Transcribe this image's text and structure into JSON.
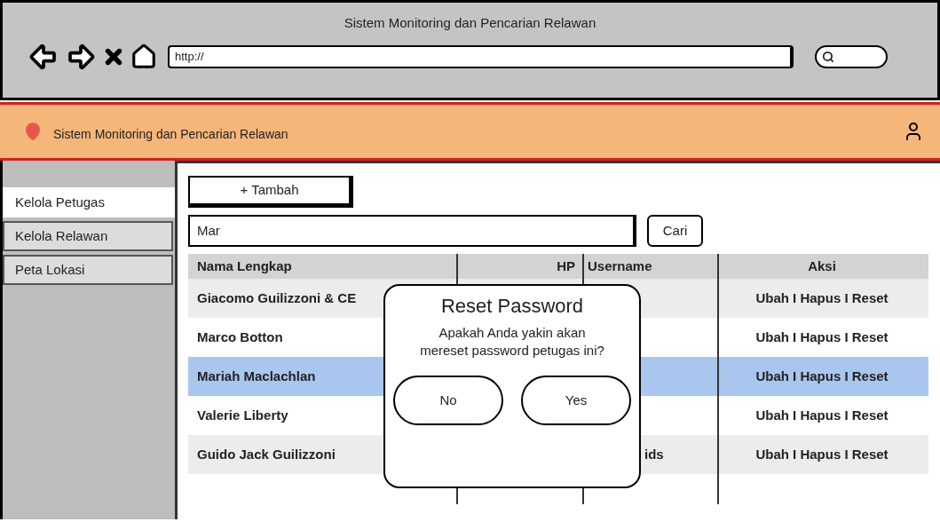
{
  "browser": {
    "title": "Sistem Monitoring dan Pencarian Relawan",
    "address": "http://"
  },
  "app_bar": {
    "title": "Sistem Monitoring dan Pencarian Relawan"
  },
  "sidebar": {
    "items": [
      {
        "label": "Kelola Petugas",
        "selected": true
      },
      {
        "label": "Kelola Relawan",
        "selected": false
      },
      {
        "label": "Peta Lokasi",
        "selected": false
      }
    ]
  },
  "add_button": "+ Tambah",
  "search": {
    "value": "Mar",
    "button": "Cari"
  },
  "table": {
    "columns": [
      "Nama Lengkap",
      "HP",
      "Username",
      "Aksi"
    ],
    "rows": [
      {
        "name": "Giacomo Guilizzoni & CE",
        "actions": "Ubah I Hapus I Reset",
        "selected": false
      },
      {
        "name": "Marco Botton",
        "actions": "Ubah I Hapus I Reset",
        "selected": false
      },
      {
        "name": "Mariah Maclachlan",
        "actions": "Ubah I Hapus I Reset",
        "selected": true
      },
      {
        "name": "Valerie Liberty",
        "actions": "Ubah I Hapus I Reset",
        "selected": false
      },
      {
        "name": "Guido Jack Guilizzoni",
        "username": "ids",
        "actions": "Ubah I Hapus I Reset",
        "selected": false
      }
    ]
  },
  "dialog": {
    "title": "Reset Password",
    "message": "Apakah Anda yakin akan mereset password petugas ini?",
    "buttons": [
      "No",
      "Yes"
    ]
  }
}
